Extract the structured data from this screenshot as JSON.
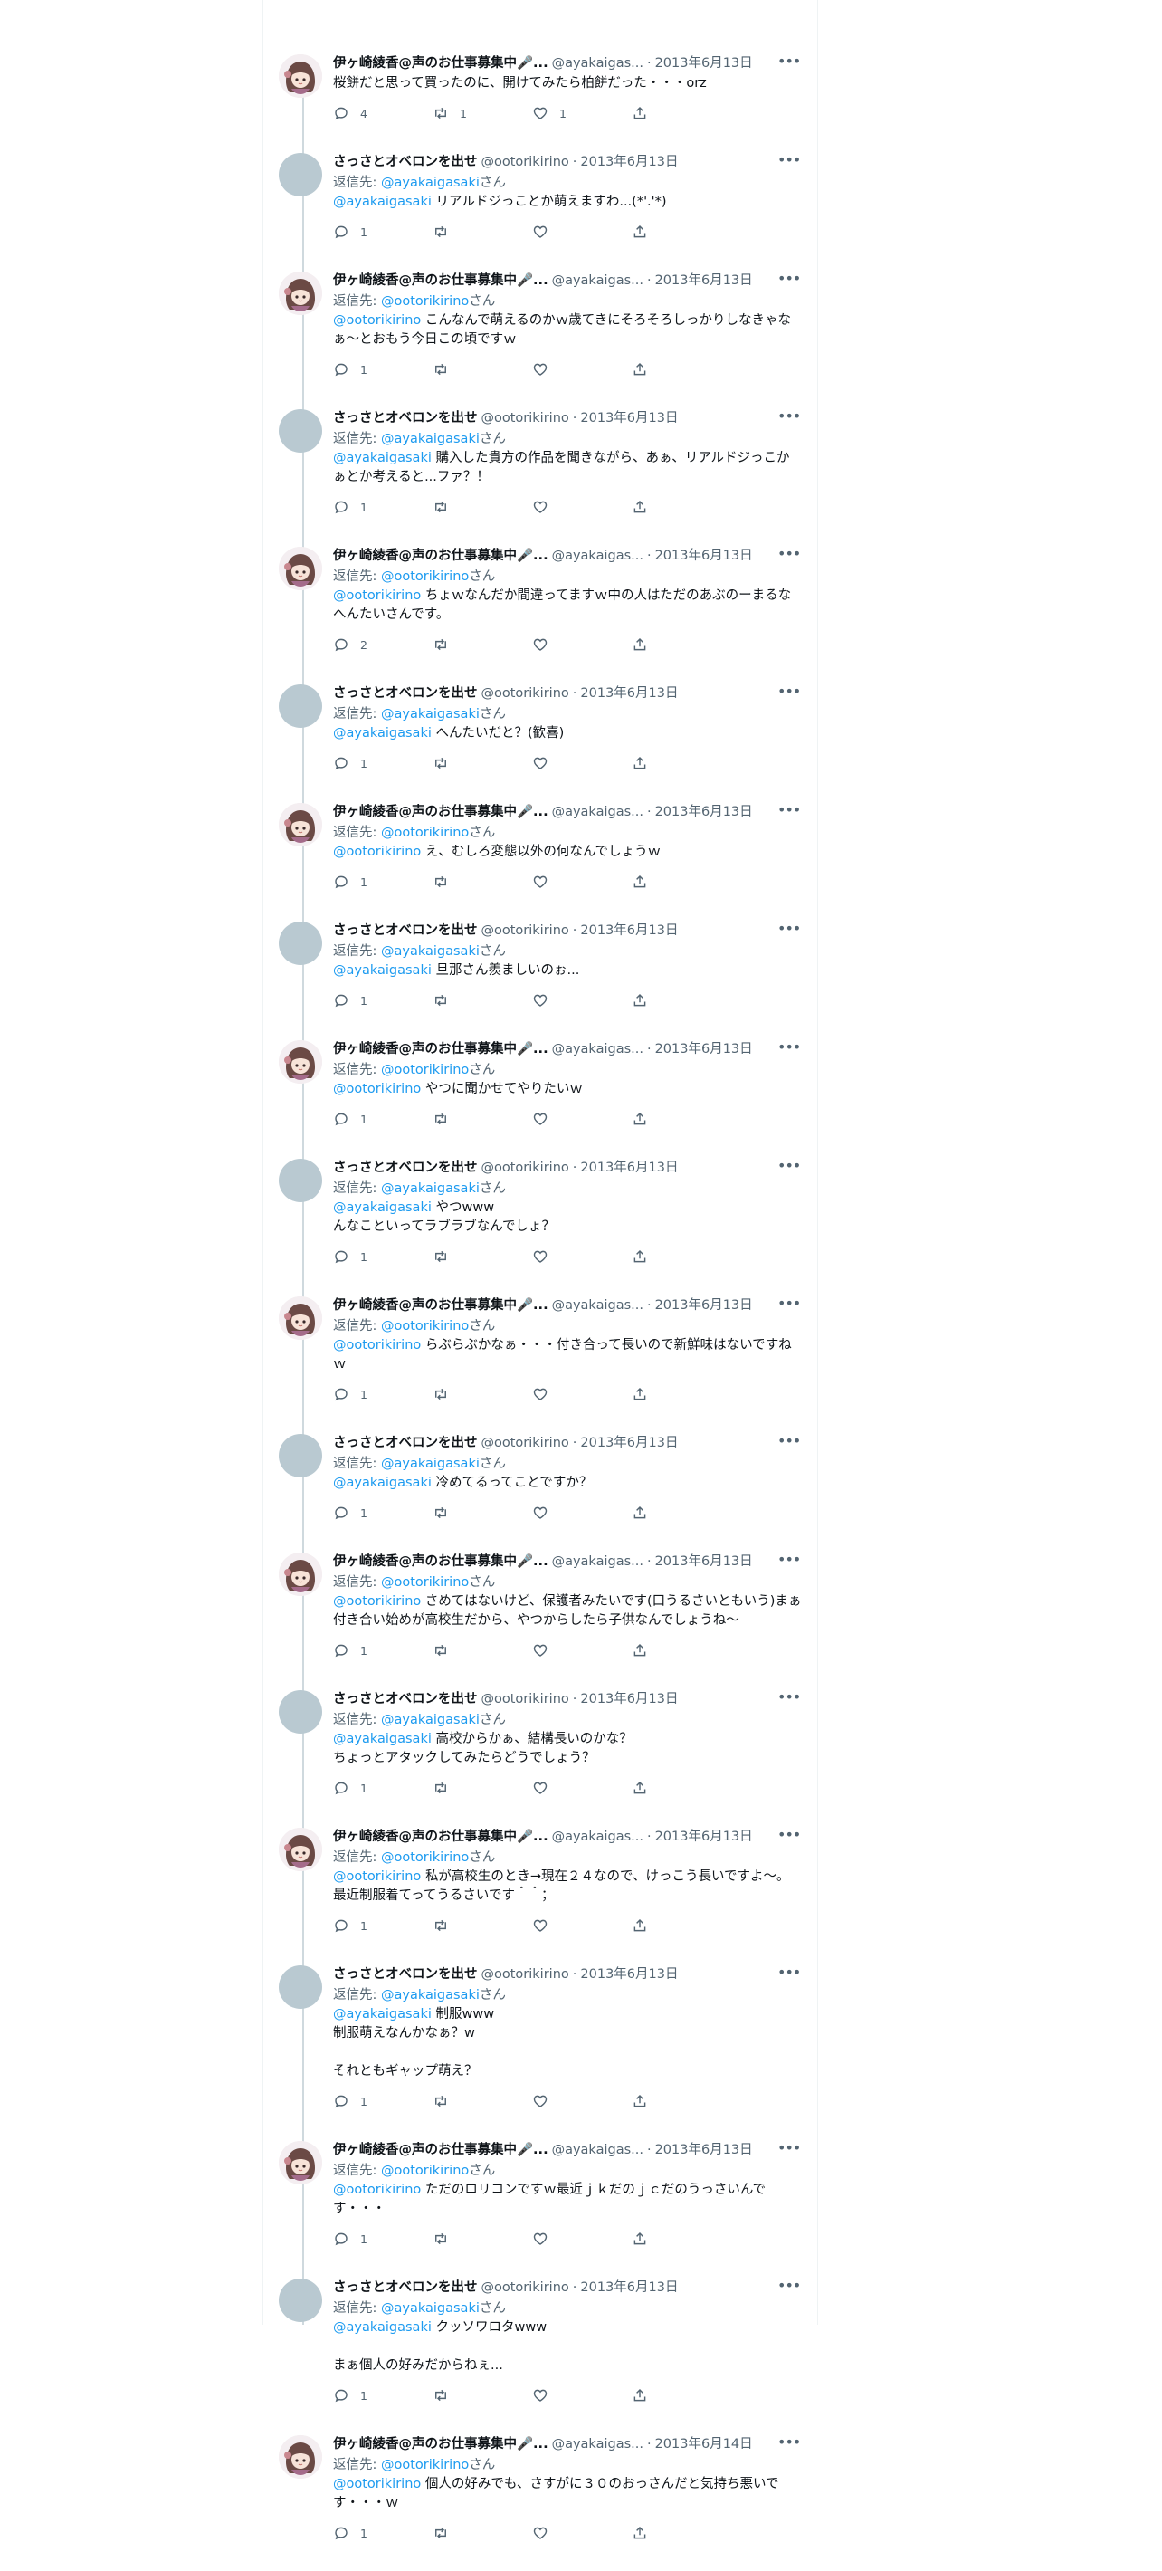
{
  "users": {
    "aya": {
      "name": "伊ヶ崎綾香@声のお仕事募集中🎤...",
      "handle": "@ayakaigas...",
      "handle_full": "@ayakaigasaki"
    },
    "oot": {
      "name": "さっさとオベロンを出せ",
      "handle": "@ootorikirino"
    }
  },
  "labels": {
    "replying_prefix": "返信先: ",
    "replying_suffix": "さん",
    "dot": "·"
  },
  "tweets": [
    {
      "user": "aya",
      "name": "伊ヶ崎綾香@声のお仕事募集中🎤...",
      "handle": "@ayakaigas...",
      "date": "2013年6月13日",
      "replying_to": "",
      "mention": "",
      "text": "桜餅だと思って買ったのに、開けてみたら柏餅だった・・・orz",
      "replies": "4",
      "retweets": "1",
      "likes": "1"
    },
    {
      "user": "oot",
      "name": "さっさとオベロンを出せ",
      "handle": "@ootorikirino",
      "date": "2013年6月13日",
      "replying_to": "@ayakaigasaki",
      "mention": "@ayakaigasaki",
      "text": " リアルドジっことか萌えますわ...(*'.'*)",
      "replies": "1",
      "retweets": "",
      "likes": ""
    },
    {
      "user": "aya",
      "name": "伊ヶ崎綾香@声のお仕事募集中🎤...",
      "handle": "@ayakaigas...",
      "date": "2013年6月13日",
      "replying_to": "@ootorikirino",
      "mention": "@ootorikirino",
      "text": " こんなんで萌えるのかｗ歳てきにそろそろしっかりしなきゃなぁ～とおもう今日この頃ですｗ",
      "replies": "1",
      "retweets": "",
      "likes": ""
    },
    {
      "user": "oot",
      "name": "さっさとオベロンを出せ",
      "handle": "@ootorikirino",
      "date": "2013年6月13日",
      "replying_to": "@ayakaigasaki",
      "mention": "@ayakaigasaki",
      "text": " 購入した貴方の作品を聞きながら、あぁ、リアルドジっこかぁとか考えると...ファ？！",
      "replies": "1",
      "retweets": "",
      "likes": ""
    },
    {
      "user": "aya",
      "name": "伊ヶ崎綾香@声のお仕事募集中🎤...",
      "handle": "@ayakaigas...",
      "date": "2013年6月13日",
      "replying_to": "@ootorikirino",
      "mention": "@ootorikirino",
      "text": " ちょｗなんだか間違ってますｗ中の人はただのあぶのーまるなへんたいさんです。",
      "replies": "2",
      "retweets": "",
      "likes": ""
    },
    {
      "user": "oot",
      "name": "さっさとオベロンを出せ",
      "handle": "@ootorikirino",
      "date": "2013年6月13日",
      "replying_to": "@ayakaigasaki",
      "mention": "@ayakaigasaki",
      "text": " へんたいだと？(歓喜)",
      "replies": "1",
      "retweets": "",
      "likes": ""
    },
    {
      "user": "aya",
      "name": "伊ヶ崎綾香@声のお仕事募集中🎤...",
      "handle": "@ayakaigas...",
      "date": "2013年6月13日",
      "replying_to": "@ootorikirino",
      "mention": "@ootorikirino",
      "text": " え、むしろ変態以外の何なんでしょうｗ",
      "replies": "1",
      "retweets": "",
      "likes": ""
    },
    {
      "user": "oot",
      "name": "さっさとオベロンを出せ",
      "handle": "@ootorikirino",
      "date": "2013年6月13日",
      "replying_to": "@ayakaigasaki",
      "mention": "@ayakaigasaki",
      "text": " 旦那さん羨ましいのぉ...",
      "replies": "1",
      "retweets": "",
      "likes": ""
    },
    {
      "user": "aya",
      "name": "伊ヶ崎綾香@声のお仕事募集中🎤...",
      "handle": "@ayakaigas...",
      "date": "2013年6月13日",
      "replying_to": "@ootorikirino",
      "mention": "@ootorikirino",
      "text": " やつに聞かせてやりたいｗ",
      "replies": "1",
      "retweets": "",
      "likes": ""
    },
    {
      "user": "oot",
      "name": "さっさとオベロンを出せ",
      "handle": "@ootorikirino",
      "date": "2013年6月13日",
      "replying_to": "@ayakaigasaki",
      "mention": "@ayakaigasaki",
      "text": " やつwww\nんなこといってラブラブなんでしょ？",
      "replies": "1",
      "retweets": "",
      "likes": ""
    },
    {
      "user": "aya",
      "name": "伊ヶ崎綾香@声のお仕事募集中🎤...",
      "handle": "@ayakaigas...",
      "date": "2013年6月13日",
      "replying_to": "@ootorikirino",
      "mention": "@ootorikirino",
      "text": " らぶらぶかなぁ・・・付き合って長いので新鮮味はないですねｗ",
      "replies": "1",
      "retweets": "",
      "likes": ""
    },
    {
      "user": "oot",
      "name": "さっさとオベロンを出せ",
      "handle": "@ootorikirino",
      "date": "2013年6月13日",
      "replying_to": "@ayakaigasaki",
      "mention": "@ayakaigasaki",
      "text": " 冷めてるってことですか？",
      "replies": "1",
      "retweets": "",
      "likes": ""
    },
    {
      "user": "aya",
      "name": "伊ヶ崎綾香@声のお仕事募集中🎤...",
      "handle": "@ayakaigas...",
      "date": "2013年6月13日",
      "replying_to": "@ootorikirino",
      "mention": "@ootorikirino",
      "text": " さめてはないけど、保護者みたいです(口うるさいともいう)まぁ付き合い始めが高校生だから、やつからしたら子供なんでしょうね～",
      "replies": "1",
      "retweets": "",
      "likes": ""
    },
    {
      "user": "oot",
      "name": "さっさとオベロンを出せ",
      "handle": "@ootorikirino",
      "date": "2013年6月13日",
      "replying_to": "@ayakaigasaki",
      "mention": "@ayakaigasaki",
      "text": " 高校からかぁ、結構長いのかな？\nちょっとアタックしてみたらどうでしょう？",
      "replies": "1",
      "retweets": "",
      "likes": ""
    },
    {
      "user": "aya",
      "name": "伊ヶ崎綾香@声のお仕事募集中🎤...",
      "handle": "@ayakaigas...",
      "date": "2013年6月13日",
      "replying_to": "@ootorikirino",
      "mention": "@ootorikirino",
      "text": " 私が高校生のとき→現在２４なので、けっこう長いですよ～。最近制服着てってうるさいです＾＾；",
      "replies": "1",
      "retweets": "",
      "likes": ""
    },
    {
      "user": "oot",
      "name": "さっさとオベロンを出せ",
      "handle": "@ootorikirino",
      "date": "2013年6月13日",
      "replying_to": "@ayakaigasaki",
      "mention": "@ayakaigasaki",
      "text": " 制服www\n制服萌えなんかなぁ？w\n\nそれともギャップ萌え？",
      "replies": "1",
      "retweets": "",
      "likes": ""
    },
    {
      "user": "aya",
      "name": "伊ヶ崎綾香@声のお仕事募集中🎤...",
      "handle": "@ayakaigas...",
      "date": "2013年6月13日",
      "replying_to": "@ootorikirino",
      "mention": "@ootorikirino",
      "text": " ただのロリコンですｗ最近ｊｋだのｊｃだのうっさいんです・・・",
      "replies": "1",
      "retweets": "",
      "likes": ""
    },
    {
      "user": "oot",
      "name": "さっさとオベロンを出せ",
      "handle": "@ootorikirino",
      "date": "2013年6月13日",
      "replying_to": "@ayakaigasaki",
      "mention": "@ayakaigasaki",
      "text": " クッソワロタwww\n\nまぁ個人の好みだからねぇ...",
      "replies": "1",
      "retweets": "",
      "likes": ""
    },
    {
      "user": "aya",
      "name": "伊ヶ崎綾香@声のお仕事募集中🎤...",
      "handle": "@ayakaigas...",
      "date": "2013年6月14日",
      "replying_to": "@ootorikirino",
      "mention": "@ootorikirino",
      "text": " 個人の好みでも、さすがに３０のおっさんだと気持ち悪いです・・・ｗ",
      "replies": "1",
      "retweets": "",
      "likes": ""
    }
  ],
  "colors": {
    "link": "#1d9bf0",
    "muted": "#536471",
    "text": "#0f1419",
    "thread_line": "#cfd9de",
    "avatar_grey": "#b9c9d1"
  },
  "icons": {
    "reply": "reply-icon",
    "retweet": "retweet-icon",
    "like": "heart-icon",
    "share": "share-icon",
    "more": "more-icon"
  }
}
